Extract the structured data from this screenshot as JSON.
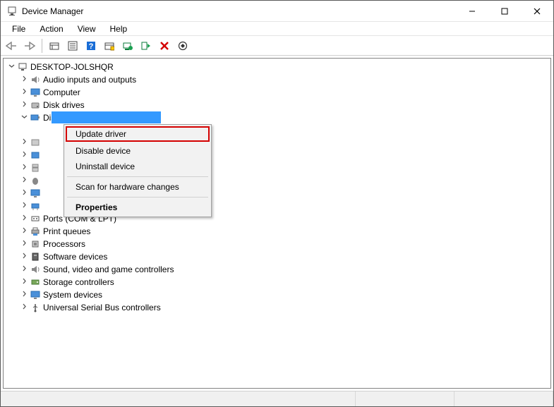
{
  "window": {
    "title": "Device Manager"
  },
  "menu": {
    "file": "File",
    "action": "Action",
    "view": "View",
    "help": "Help"
  },
  "tree": {
    "root": "DESKTOP-JOLSHQR",
    "items": [
      {
        "label": "Audio inputs and outputs",
        "expanded": false
      },
      {
        "label": "Computer",
        "expanded": false
      },
      {
        "label": "Disk drives",
        "expanded": false
      },
      {
        "label": "Display adapters",
        "expanded": true
      }
    ],
    "items2": [
      {
        "label": "Ports (COM & LPT)",
        "expanded": false
      },
      {
        "label": "Print queues",
        "expanded": false
      },
      {
        "label": "Processors",
        "expanded": false
      },
      {
        "label": "Software devices",
        "expanded": false
      },
      {
        "label": "Sound, video and game controllers",
        "expanded": false
      },
      {
        "label": "Storage controllers",
        "expanded": false
      },
      {
        "label": "System devices",
        "expanded": false
      },
      {
        "label": "Universal Serial Bus controllers",
        "expanded": false
      }
    ]
  },
  "context_menu": {
    "update": "Update driver",
    "disable": "Disable device",
    "uninstall": "Uninstall device",
    "scan": "Scan for hardware changes",
    "properties": "Properties"
  }
}
